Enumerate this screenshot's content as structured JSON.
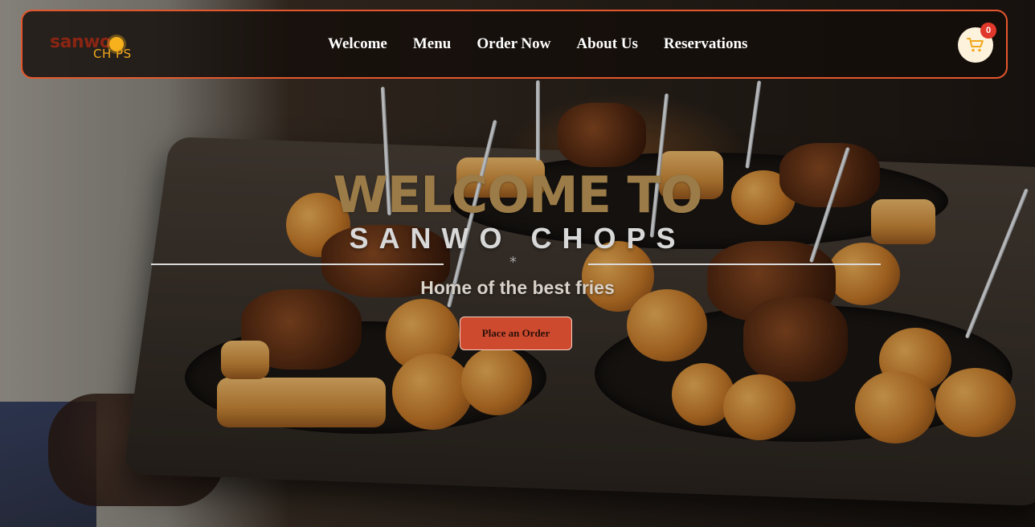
{
  "brand": {
    "logo_main": "sanwo",
    "logo_sub": "CH PS"
  },
  "nav": {
    "items": [
      {
        "label": "Welcome"
      },
      {
        "label": "Menu"
      },
      {
        "label": "Order Now"
      },
      {
        "label": "About Us"
      },
      {
        "label": "Reservations"
      }
    ]
  },
  "cart": {
    "count": "0",
    "icon": "cart-icon"
  },
  "hero": {
    "title": "WELCOME TO",
    "brand": "SANWO CHOPS",
    "divider_symbol": "*",
    "tagline": "Home of the best fries",
    "cta_label": "Place an Order"
  },
  "colors": {
    "accent": "#e4572e",
    "button": "#cd4a2f",
    "title": "#9b7b47",
    "logo_primary": "#8a2413",
    "logo_secondary": "#f2a81c",
    "badge": "#e0392b"
  }
}
